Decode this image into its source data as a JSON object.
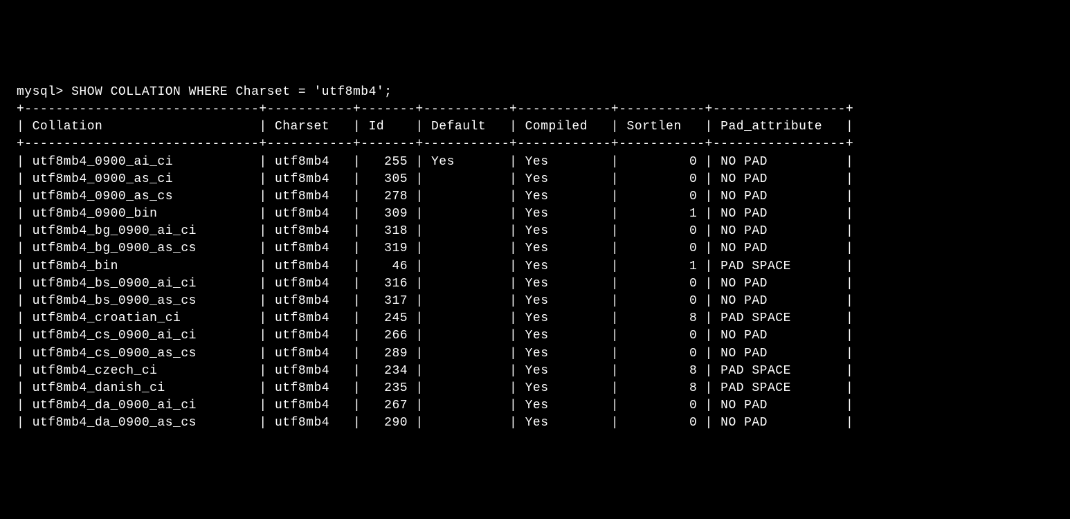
{
  "prompt": "mysql> ",
  "command": "SHOW COLLATION WHERE Charset = 'utf8mb4';",
  "columns": [
    {
      "name": "Collation",
      "width": 28,
      "align": "left"
    },
    {
      "name": "Charset",
      "width": 9,
      "align": "left"
    },
    {
      "name": "Id",
      "width": 5,
      "align": "right"
    },
    {
      "name": "Default",
      "width": 9,
      "align": "left"
    },
    {
      "name": "Compiled",
      "width": 10,
      "align": "left"
    },
    {
      "name": "Sortlen",
      "width": 9,
      "align": "right"
    },
    {
      "name": "Pad_attribute",
      "width": 15,
      "align": "left"
    }
  ],
  "rows": [
    {
      "Collation": "utf8mb4_0900_ai_ci",
      "Charset": "utf8mb4",
      "Id": "255",
      "Default": "Yes",
      "Compiled": "Yes",
      "Sortlen": "0",
      "Pad_attribute": "NO PAD"
    },
    {
      "Collation": "utf8mb4_0900_as_ci",
      "Charset": "utf8mb4",
      "Id": "305",
      "Default": "",
      "Compiled": "Yes",
      "Sortlen": "0",
      "Pad_attribute": "NO PAD"
    },
    {
      "Collation": "utf8mb4_0900_as_cs",
      "Charset": "utf8mb4",
      "Id": "278",
      "Default": "",
      "Compiled": "Yes",
      "Sortlen": "0",
      "Pad_attribute": "NO PAD"
    },
    {
      "Collation": "utf8mb4_0900_bin",
      "Charset": "utf8mb4",
      "Id": "309",
      "Default": "",
      "Compiled": "Yes",
      "Sortlen": "1",
      "Pad_attribute": "NO PAD"
    },
    {
      "Collation": "utf8mb4_bg_0900_ai_ci",
      "Charset": "utf8mb4",
      "Id": "318",
      "Default": "",
      "Compiled": "Yes",
      "Sortlen": "0",
      "Pad_attribute": "NO PAD"
    },
    {
      "Collation": "utf8mb4_bg_0900_as_cs",
      "Charset": "utf8mb4",
      "Id": "319",
      "Default": "",
      "Compiled": "Yes",
      "Sortlen": "0",
      "Pad_attribute": "NO PAD"
    },
    {
      "Collation": "utf8mb4_bin",
      "Charset": "utf8mb4",
      "Id": "46",
      "Default": "",
      "Compiled": "Yes",
      "Sortlen": "1",
      "Pad_attribute": "PAD SPACE"
    },
    {
      "Collation": "utf8mb4_bs_0900_ai_ci",
      "Charset": "utf8mb4",
      "Id": "316",
      "Default": "",
      "Compiled": "Yes",
      "Sortlen": "0",
      "Pad_attribute": "NO PAD"
    },
    {
      "Collation": "utf8mb4_bs_0900_as_cs",
      "Charset": "utf8mb4",
      "Id": "317",
      "Default": "",
      "Compiled": "Yes",
      "Sortlen": "0",
      "Pad_attribute": "NO PAD"
    },
    {
      "Collation": "utf8mb4_croatian_ci",
      "Charset": "utf8mb4",
      "Id": "245",
      "Default": "",
      "Compiled": "Yes",
      "Sortlen": "8",
      "Pad_attribute": "PAD SPACE"
    },
    {
      "Collation": "utf8mb4_cs_0900_ai_ci",
      "Charset": "utf8mb4",
      "Id": "266",
      "Default": "",
      "Compiled": "Yes",
      "Sortlen": "0",
      "Pad_attribute": "NO PAD"
    },
    {
      "Collation": "utf8mb4_cs_0900_as_cs",
      "Charset": "utf8mb4",
      "Id": "289",
      "Default": "",
      "Compiled": "Yes",
      "Sortlen": "0",
      "Pad_attribute": "NO PAD"
    },
    {
      "Collation": "utf8mb4_czech_ci",
      "Charset": "utf8mb4",
      "Id": "234",
      "Default": "",
      "Compiled": "Yes",
      "Sortlen": "8",
      "Pad_attribute": "PAD SPACE"
    },
    {
      "Collation": "utf8mb4_danish_ci",
      "Charset": "utf8mb4",
      "Id": "235",
      "Default": "",
      "Compiled": "Yes",
      "Sortlen": "8",
      "Pad_attribute": "PAD SPACE"
    },
    {
      "Collation": "utf8mb4_da_0900_ai_ci",
      "Charset": "utf8mb4",
      "Id": "267",
      "Default": "",
      "Compiled": "Yes",
      "Sortlen": "0",
      "Pad_attribute": "NO PAD"
    },
    {
      "Collation": "utf8mb4_da_0900_as_cs",
      "Charset": "utf8mb4",
      "Id": "290",
      "Default": "",
      "Compiled": "Yes",
      "Sortlen": "0",
      "Pad_attribute": "NO PAD"
    }
  ]
}
